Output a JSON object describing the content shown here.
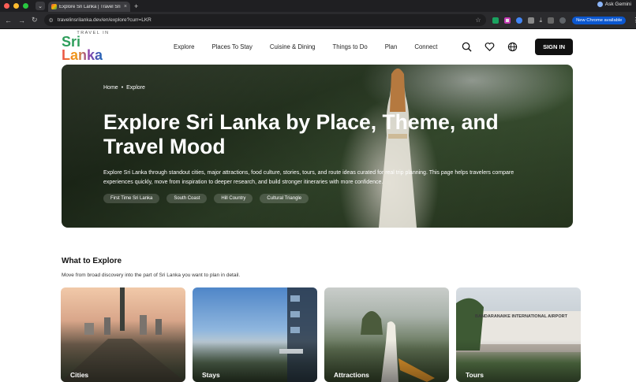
{
  "browser": {
    "tab_title": "Explore Sri Lanka | Travel Sri Lanka",
    "tab_close": "×",
    "new_tab": "+",
    "ask": "Ask Gemini",
    "url": "travelinsrilanka.dev/en/explore?curr=LKR",
    "update_label": "New Chrome available"
  },
  "site": {
    "logo_top": "TRAVEL IN",
    "logo_sri": "Sri",
    "logo_lanka": "Lanka",
    "nav": [
      "Explore",
      "Places To Stay",
      "Cuisine & Dining",
      "Things to Do",
      "Plan",
      "Connect"
    ],
    "signin_label": "SIGN IN"
  },
  "hero": {
    "breadcrumb": [
      "Home",
      "Explore"
    ],
    "separator": "•",
    "title": "Explore Sri Lanka by Place, Theme, and Travel Mood",
    "description": "Explore Sri Lanka through standout cities, major attractions, food culture, stories, tours, and route ideas curated for real trip planning. This page helps travelers compare experiences quickly, move from inspiration to deeper research, and build stronger itineraries with more confidence.",
    "chips": [
      "First Time Sri Lanka",
      "South Coast",
      "Hill Country",
      "Cultural Triangle"
    ]
  },
  "explore": {
    "title": "What to Explore",
    "subtitle": "Move from broad discovery into the part of Sri Lanka you want to plan in detail.",
    "cards": [
      "Cities",
      "Stays",
      "Attractions",
      "Tours"
    ],
    "airport_sign": "BANDARANAIKE INTERNATIONAL AIRPORT"
  },
  "colors": {
    "signin_bg": "#111111",
    "update_badge": "#0b57d0"
  }
}
